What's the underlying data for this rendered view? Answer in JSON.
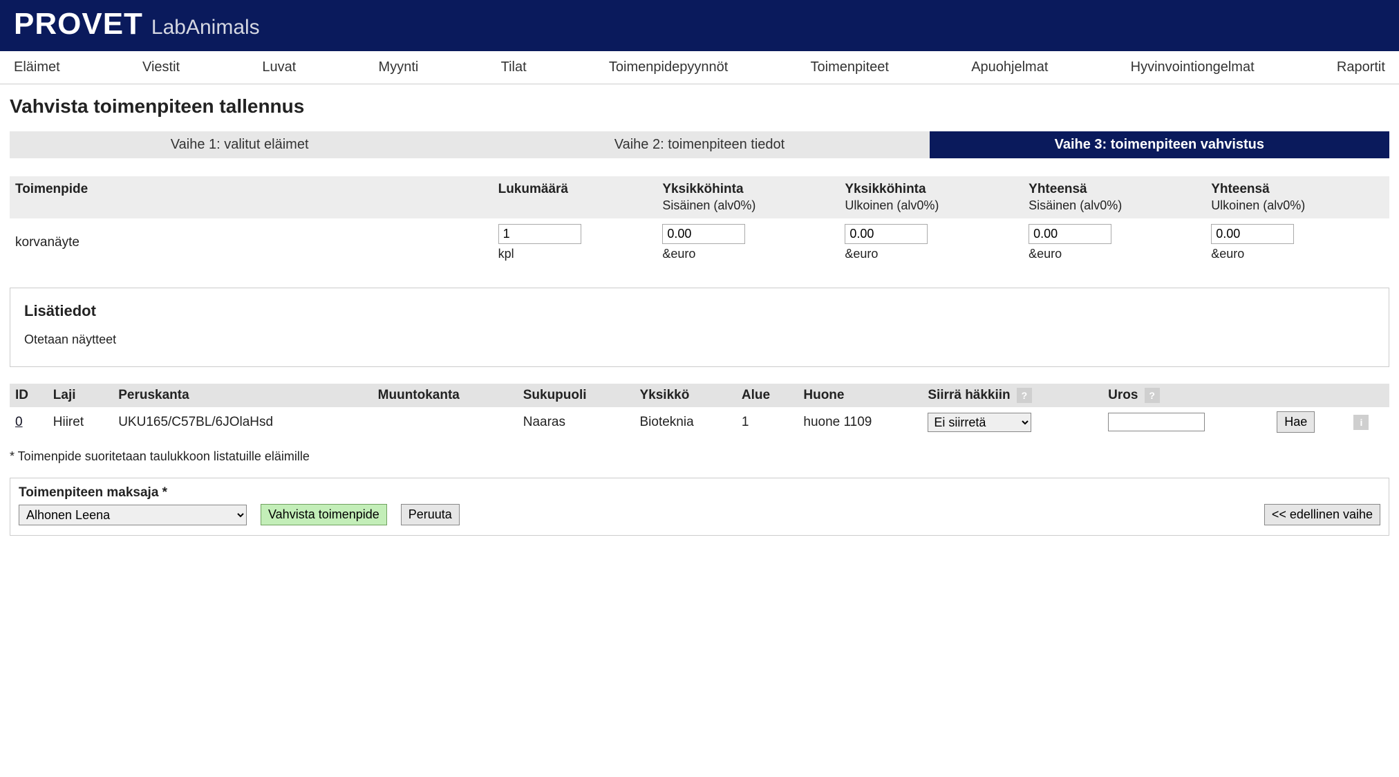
{
  "brand": {
    "main": "PROVET",
    "sub": "LabAnimals"
  },
  "nav": [
    "Eläimet",
    "Viestit",
    "Luvat",
    "Myynti",
    "Tilat",
    "Toimenpidepyynnöt",
    "Toimenpiteet",
    "Apuohjelmat",
    "Hyvinvointiongelmat",
    "Raportit"
  ],
  "page_title": "Vahvista toimenpiteen tallennus",
  "wizard": {
    "step1": "Vaihe 1: valitut eläimet",
    "step2": "Vaihe 2: toimenpiteen tiedot",
    "step3": "Vaihe 3: toimenpiteen vahvistus"
  },
  "price": {
    "headers": {
      "toimenpide": "Toimenpide",
      "lukumaara": "Lukumäärä",
      "yks_sis": "Yksikköhinta",
      "yks_sis_sub": "Sisäinen (alv0%)",
      "yks_ulk": "Yksikköhinta",
      "yks_ulk_sub": "Ulkoinen (alv0%)",
      "yht_sis": "Yhteensä",
      "yht_sis_sub": "Sisäinen (alv0%)",
      "yht_ulk": "Yhteensä",
      "yht_ulk_sub": "Ulkoinen (alv0%)"
    },
    "row": {
      "name": "korvanäyte",
      "count": "1",
      "count_unit": "kpl",
      "p1": "0.00",
      "p2": "0.00",
      "p3": "0.00",
      "p4": "0.00",
      "currency": "&euro"
    }
  },
  "info": {
    "heading": "Lisätiedot",
    "text": "Otetaan näytteet"
  },
  "animals": {
    "headers": {
      "id": "ID",
      "laji": "Laji",
      "peruskanta": "Peruskanta",
      "muuntokanta": "Muuntokanta",
      "sukupuoli": "Sukupuoli",
      "yksikko": "Yksikkö",
      "alue": "Alue",
      "huone": "Huone",
      "siirra": "Siirrä häkkiin",
      "uros": "Uros"
    },
    "row": {
      "id": "0",
      "laji": "Hiiret",
      "peruskanta": "UKU165/C57BL/6JOlaHsd",
      "muuntokanta": "",
      "sukupuoli": "Naaras",
      "yksikko": "Bioteknia",
      "alue": "1",
      "huone": "huone 1109",
      "siirra_value": "Ei siirretä",
      "uros_value": "",
      "hae_label": "Hae"
    }
  },
  "footnote": "* Toimenpide suoritetaan taulukkoon listatuille eläimille",
  "payer": {
    "label": "Toimenpiteen maksaja *",
    "value": "Alhonen Leena",
    "confirm_label": "Vahvista toimenpide",
    "cancel_label": "Peruuta",
    "prev_label": "<< edellinen vaihe"
  },
  "help_char": "?",
  "info_char": "i"
}
